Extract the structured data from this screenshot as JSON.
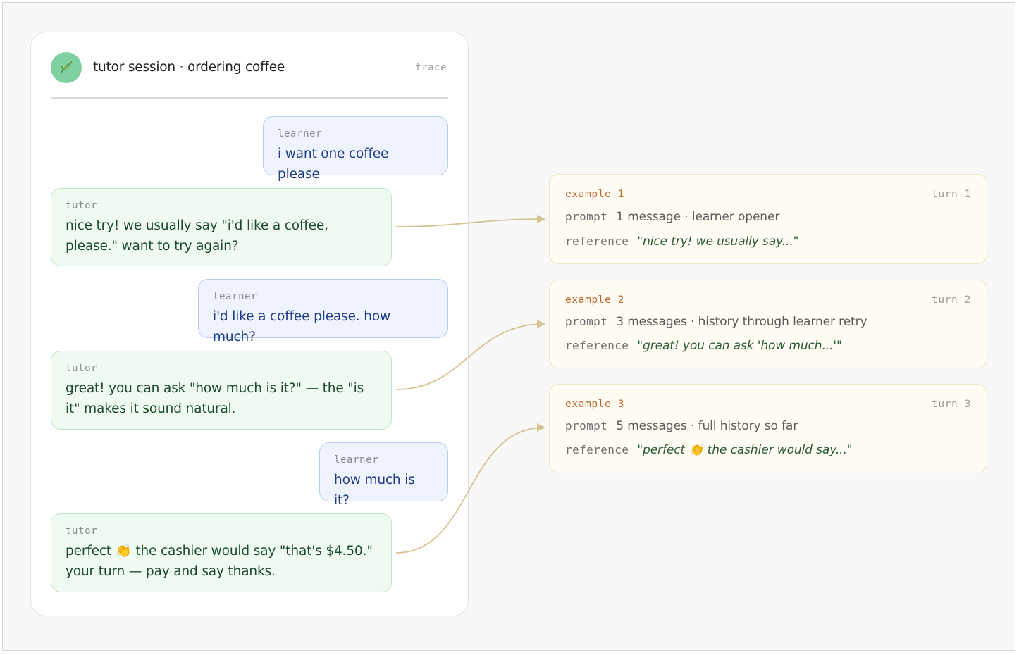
{
  "session": {
    "avatar_icon": "leaf-icon",
    "title": "tutor session · ordering coffee",
    "trace_label": "trace"
  },
  "messages": [
    {
      "role": "learner",
      "text": "i want one coffee please"
    },
    {
      "role": "tutor",
      "text": "nice try! we usually say \"i'd like a coffee, please.\" want to try again?"
    },
    {
      "role": "learner",
      "text": "i'd like a coffee please. how much?"
    },
    {
      "role": "tutor",
      "text": "great! you can ask \"how much is it?\" — the \"is it\" makes it sound natural."
    },
    {
      "role": "learner",
      "text": "how much is it?"
    },
    {
      "role": "tutor",
      "text": "perfect 👏 the cashier would say \"that's $4.50.\" your turn — pay and say thanks."
    }
  ],
  "examples": [
    {
      "label": "example 1",
      "turn": "turn 1",
      "prompt_label": "prompt",
      "prompt_value": "1 message · learner opener",
      "reference_label": "reference",
      "reference_value": "\"nice try! we usually say...\""
    },
    {
      "label": "example 2",
      "turn": "turn 2",
      "prompt_label": "prompt",
      "prompt_value": "3 messages · history through learner retry",
      "reference_label": "reference",
      "reference_value": "\"great! you can ask 'how much...'\""
    },
    {
      "label": "example 3",
      "turn": "turn 3",
      "prompt_label": "prompt",
      "prompt_value": "5 messages · full history so far",
      "reference_label": "reference",
      "reference_value": "\"perfect 👏 the cashier would say...\""
    }
  ],
  "colors": {
    "learner_text": "#1f3c8a",
    "tutor_text": "#1e4a2a",
    "example_accent": "#c0652c",
    "arrow": "#d4c390"
  }
}
